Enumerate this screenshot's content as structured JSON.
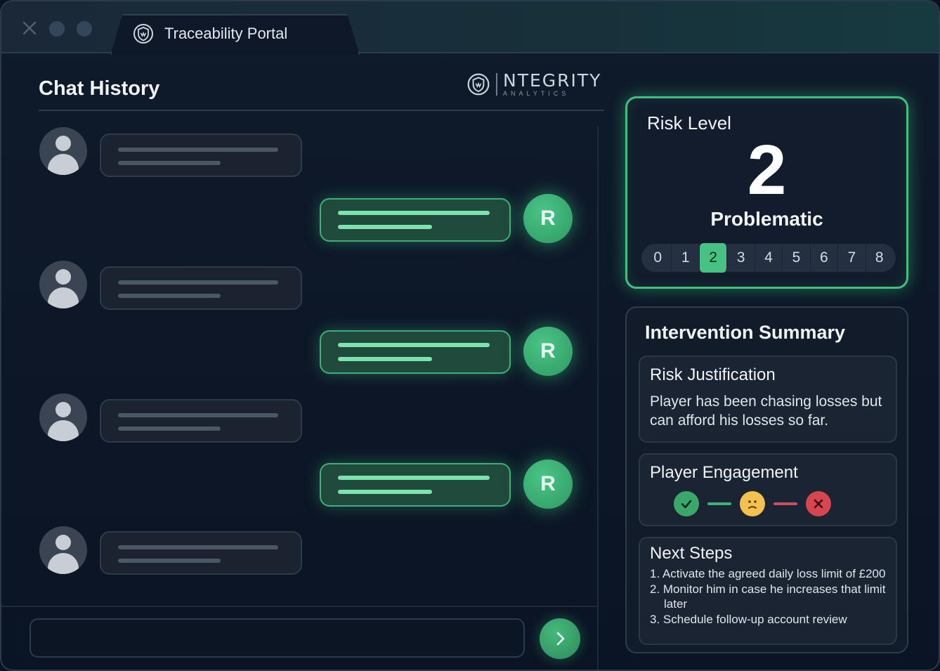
{
  "window": {
    "tab_title": "Traceability Portal",
    "tab_icon": "shield-logo-icon"
  },
  "brand": {
    "name": "NTEGRITY",
    "subtitle": "ANALYTICS",
    "icon": "shield-logo-icon"
  },
  "chat": {
    "title": "Chat History",
    "messages": [
      {
        "sender": "user",
        "avatar": "user-avatar-icon"
      },
      {
        "sender": "bot",
        "avatar_letter": "R"
      },
      {
        "sender": "user",
        "avatar": "user-avatar-icon"
      },
      {
        "sender": "bot",
        "avatar_letter": "R"
      },
      {
        "sender": "user",
        "avatar": "user-avatar-icon"
      },
      {
        "sender": "bot",
        "avatar_letter": "R"
      },
      {
        "sender": "user",
        "avatar": "user-avatar-icon"
      }
    ],
    "input_placeholder": "",
    "send_icon": "chevron-right-icon"
  },
  "risk": {
    "title": "Risk Level",
    "value": "2",
    "label": "Problematic",
    "scale": [
      "0",
      "1",
      "2",
      "3",
      "4",
      "5",
      "6",
      "7",
      "8"
    ],
    "selected_index": 2
  },
  "summary": {
    "title": "Intervention Summary",
    "justification": {
      "title": "Risk Justification",
      "text": "Player has been chasing losses but can afford his losses so far."
    },
    "engagement": {
      "title": "Player Engagement",
      "icons": [
        "check-circle-icon",
        "neutral-face-icon",
        "x-circle-icon"
      ],
      "status": "neutral"
    },
    "next_steps": {
      "title": "Next Steps",
      "items": [
        "1. Activate the agreed daily loss limit of £200",
        "2. Monitor him in case he increases that limit later",
        "3. Schedule follow-up account review"
      ]
    }
  },
  "colors": {
    "accent_green": "#47c184",
    "warning_yellow": "#f2c14e",
    "danger_red": "#d64550",
    "background": "#0b1424"
  }
}
